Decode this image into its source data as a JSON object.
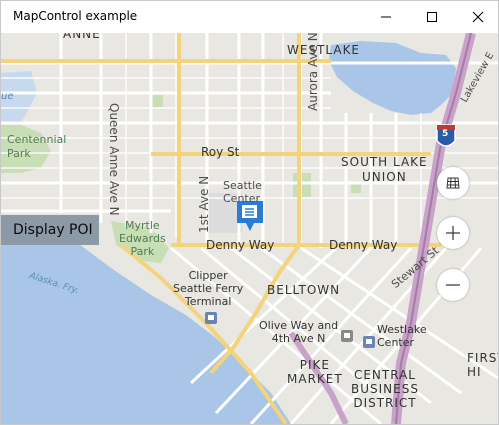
{
  "window": {
    "title": "MapControl example"
  },
  "map": {
    "labels": {
      "anne": "ANNE",
      "westlake": "WESTLAKE",
      "queen_anne_ave": "Queen Anne Ave N",
      "aurora_ave": "Aurora Ave N",
      "ue": "ue",
      "centennial_park": "Centennial\nPark",
      "roy_st": "Roy St",
      "south_lake_union": "SOUTH LAKE\nUNION",
      "seattle_center": "Seattle\nCenter",
      "first_ave": "1st Ave N",
      "myrtle_edwards": "Myrtle\nEdwards\nPark",
      "denny_way_1": "Denny Way",
      "denny_way_2": "Denny Way",
      "stewart_st": "Stewart St",
      "lakeview": "Lakeview E",
      "alaska_fry": "Alaska. Fry.",
      "clipper": "Clipper\nSeattle Ferry\nTerminal",
      "belltown": "BELLTOWN",
      "olive_way": "Olive Way and\n4th Ave N",
      "westlake_center": "Westlake\nCenter",
      "pike_market": "PIKE\nMARKET",
      "cbd": "CENTRAL\nBUSINESS\nDISTRICT",
      "first_hill": "FIRST\nHI"
    },
    "highway_shield": "5",
    "poi_button_label": "Display POI",
    "controls": {
      "map_style_icon": "grid-icon",
      "zoom_in_icon": "plus-icon",
      "zoom_out_icon": "minus-icon"
    },
    "colors": {
      "land": "#e9e7e1",
      "water": "#a9c6e8",
      "park": "#c8dfb5",
      "highway": "#c8a2c8",
      "arterial": "#f3d47a",
      "road": "#ffffff",
      "pin": "#2a7bd6"
    }
  }
}
